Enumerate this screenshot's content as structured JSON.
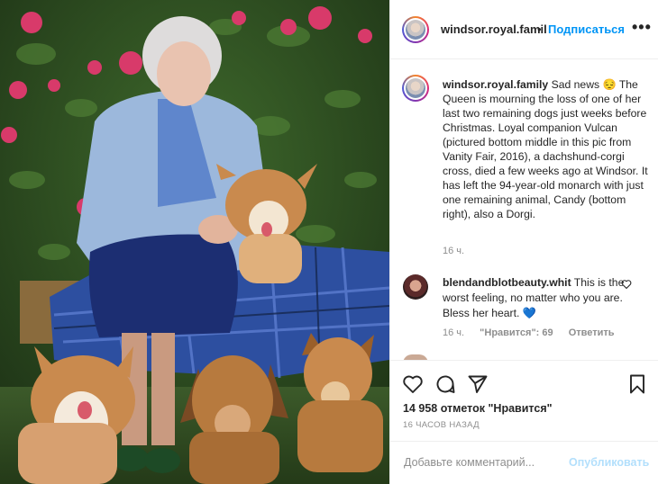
{
  "post": {
    "username": "windsor.royal.family",
    "header_username": "windsor.royal.famil",
    "dot": "•",
    "follow_label": "Подписаться",
    "more_label": "•••"
  },
  "caption": {
    "username": "windsor.royal.family",
    "text": " Sad news 😔 The Queen is mourning the loss of one of her last two remaining dogs just weeks before Christmas. Loyal companion Vulcan (pictured bottom middle in this pic from Vanity Fair, 2016), a dachshund-corgi cross, died a few weeks ago at Windsor. It has left the 94-year-old monarch with just one remaining animal, Candy (bottom right), also a Dorgi.",
    "time": "16 ч."
  },
  "comment": {
    "username": "blendandblotbeauty.whit",
    "text": " This is the worst feeling, no matter who you are. Bless her heart. 💙",
    "time": "16 ч.",
    "likes": "\"Нравится\": 69",
    "reply": "Ответить"
  },
  "actions": {
    "likes_text": "14 958 отметок \"Нравится\"",
    "time_ago": "16 ЧАСОВ НАЗАД"
  },
  "add_comment": {
    "placeholder": "Добавьте комментарий...",
    "publish_label": "Опубликовать"
  },
  "colors": {
    "accent": "#0095f6",
    "publish_disabled": "#b2dffc",
    "muted": "#8e8e8e"
  }
}
